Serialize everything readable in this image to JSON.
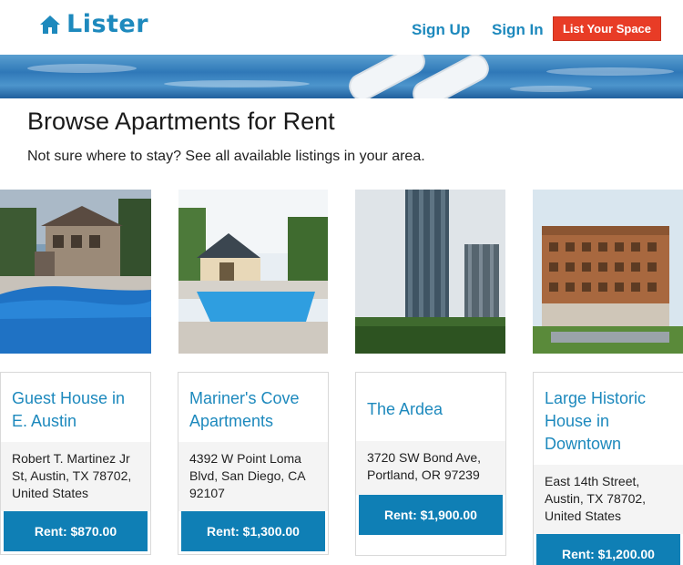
{
  "header": {
    "logo_text": "Lister",
    "nav": {
      "sign_up": "Sign Up",
      "sign_in": "Sign In"
    },
    "list_space_label": "List Your Space"
  },
  "hero": {
    "title": "Browse Apartments for Rent",
    "subtitle": "Not sure where to stay? See all available listings in your area."
  },
  "listings": [
    {
      "title": "Guest House in E. Austin",
      "address": "Robert T. Martinez Jr St, Austin, TX 78702, United States",
      "rent": "Rent: $870.00"
    },
    {
      "title": "Mariner's Cove Apartments",
      "address": "4392 W Point Loma Blvd, San Diego, CA 92107",
      "rent": "Rent: $1,300.00"
    },
    {
      "title": "The Ardea",
      "address": "3720 SW Bond Ave, Portland, OR 97239",
      "rent": "Rent: $1,900.00"
    },
    {
      "title": "Large Historic House in Downtown",
      "address": "East 14th Street, Austin, TX 78702, United States",
      "rent": "Rent: $1,200.00"
    }
  ],
  "colors": {
    "brand": "#1d89bd",
    "cta": "#e83c26",
    "rent_button": "#0f7fb5"
  }
}
